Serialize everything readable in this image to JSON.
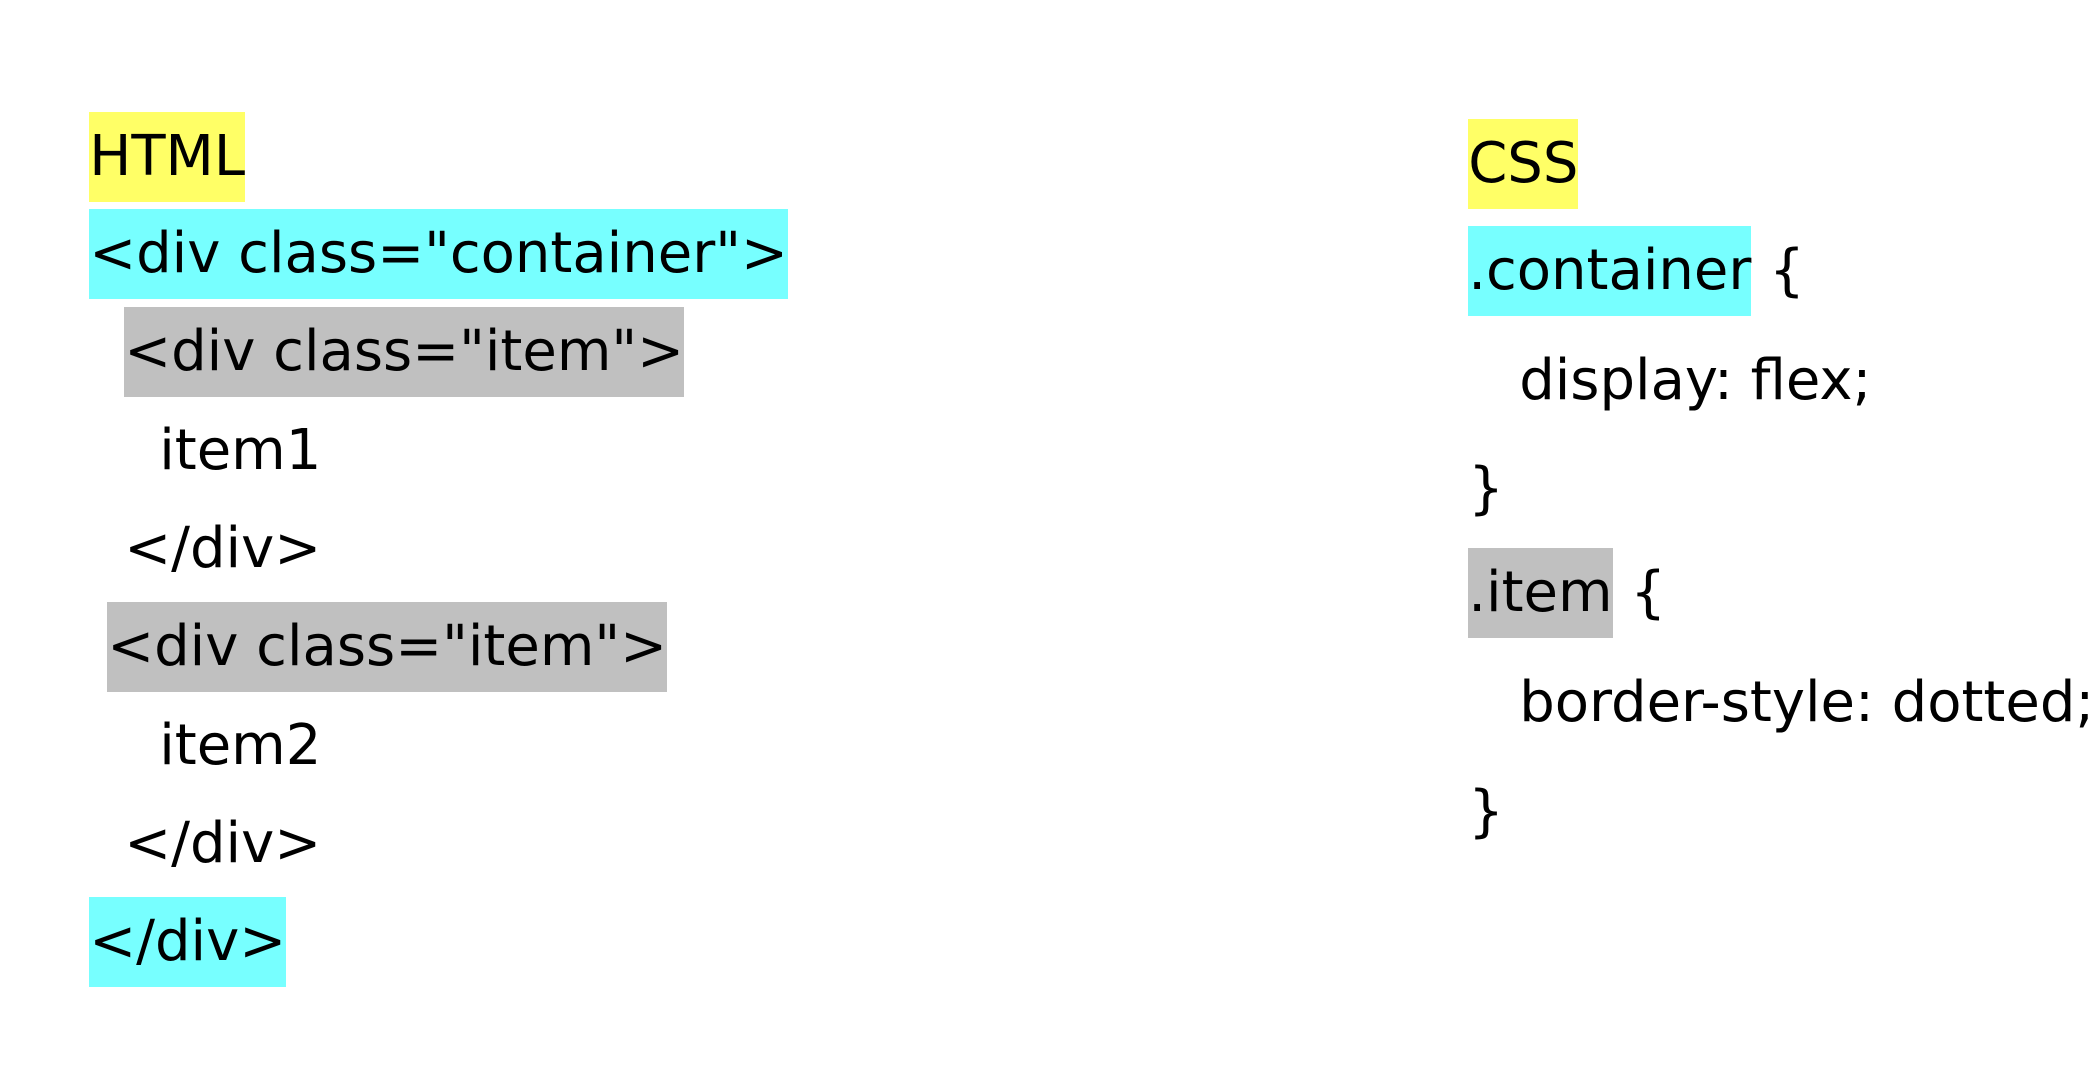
{
  "colors": {
    "heading_highlight": "#ffff66",
    "container_highlight": "#77ffff",
    "item_highlight": "#c0c0c0",
    "text": "#000000",
    "background": "#ffffff"
  },
  "html_panel": {
    "heading": "HTML",
    "lines": [
      "<div class=\"container\">",
      "<div class=\"item\">",
      "item1",
      "</div>",
      "<div class=\"item\">",
      "item2",
      "</div>",
      "</div>"
    ]
  },
  "css_panel": {
    "heading": "CSS",
    "container_selector": ".container",
    "container_open": " {",
    "container_decl": "display: flex;",
    "container_close": "}",
    "item_selector": ".item",
    "item_open": " {",
    "item_decl": "border-style: dotted;",
    "item_close": "}"
  }
}
